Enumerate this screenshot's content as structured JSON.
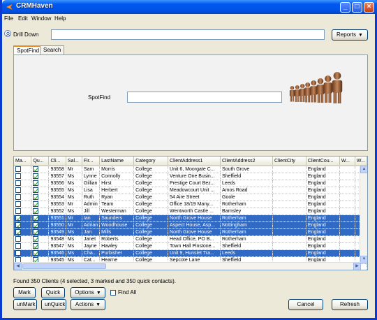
{
  "window": {
    "title": "CRMHaven"
  },
  "menu": [
    "File",
    "Edit",
    "Window",
    "Help"
  ],
  "drill_down": {
    "label": "Drill Down",
    "value": ""
  },
  "reports_button": "Reports",
  "tabs": [
    "SpotFind",
    "Search"
  ],
  "spotfind": {
    "label": "SpotFind",
    "value": ""
  },
  "grid": {
    "columns": [
      "Ma...",
      "Qu...",
      "Cli...",
      "Sal...",
      "Fir...",
      "LastName",
      "Category",
      "ClientAddress1",
      "ClientAddress2",
      "ClientCity",
      "ClientCou...",
      "W...",
      "W..."
    ],
    "rows": [
      {
        "mark": false,
        "quick": true,
        "id": "93558",
        "sal": "Mr",
        "first": "Sam",
        "last": "Morris",
        "cat": "College",
        "addr1": "Unit 6, Moorgate C...",
        "addr2": "South Grove",
        "city": "",
        "country": "England",
        "selected": false
      },
      {
        "mark": false,
        "quick": true,
        "id": "93557",
        "sal": "Ms",
        "first": "Lynne",
        "last": "Connolly",
        "cat": "College",
        "addr1": "Venture One Busin...",
        "addr2": "Sheffield",
        "city": "",
        "country": "England",
        "selected": false
      },
      {
        "mark": false,
        "quick": true,
        "id": "93556",
        "sal": "Ms",
        "first": "Gillian",
        "last": "Hirst",
        "cat": "College",
        "addr1": "Prestige Court Bez...",
        "addr2": "Leeds",
        "city": "",
        "country": "England",
        "selected": false
      },
      {
        "mark": false,
        "quick": true,
        "id": "93555",
        "sal": "Ms",
        "first": "Lisa",
        "last": "Herbert",
        "cat": "College",
        "addr1": "Meadowcourt Unit ...",
        "addr2": "Amos Road",
        "city": "",
        "country": "England",
        "selected": false
      },
      {
        "mark": false,
        "quick": true,
        "id": "93554",
        "sal": "Ms",
        "first": "Ruth",
        "last": "Ryan",
        "cat": "College",
        "addr1": "54 Aire Street",
        "addr2": "Goole",
        "city": "",
        "country": "England",
        "selected": false
      },
      {
        "mark": false,
        "quick": true,
        "id": "93553",
        "sal": "Mr",
        "first": "Admin",
        "last": "Team",
        "cat": "College",
        "addr1": "Office 18/19 Many...",
        "addr2": "Rotherham",
        "city": "",
        "country": "England",
        "selected": false
      },
      {
        "mark": false,
        "quick": true,
        "id": "93552",
        "sal": "Ms",
        "first": "Jill",
        "last": "Westerman",
        "cat": "College",
        "addr1": "Wentworth Castle ...",
        "addr2": "Barnsley",
        "city": "",
        "country": "England",
        "selected": false
      },
      {
        "mark": true,
        "quick": true,
        "id": "93551",
        "sal": "Mr",
        "first": "Ian",
        "last": "Saunders",
        "cat": "College",
        "addr1": "North Grove House",
        "addr2": "Rotherham",
        "city": "",
        "country": "England",
        "selected": true
      },
      {
        "mark": true,
        "quick": true,
        "id": "93550",
        "sal": "Mr",
        "first": "Adrian",
        "last": "Woodhouse",
        "cat": "College",
        "addr1": "Aspect House, Asp...",
        "addr2": "Nottingham",
        "city": "",
        "country": "England",
        "selected": true
      },
      {
        "mark": true,
        "quick": true,
        "id": "93549",
        "sal": "Ms",
        "first": "Jan",
        "last": "Mills",
        "cat": "College",
        "addr1": "North Grove House",
        "addr2": "Rotherham",
        "city": "",
        "country": "England",
        "selected": true
      },
      {
        "mark": false,
        "quick": true,
        "id": "93548",
        "sal": "Ms",
        "first": "Janet",
        "last": "Roberts",
        "cat": "College",
        "addr1": "Head Office, PO B...",
        "addr2": "Rotherham",
        "city": "",
        "country": "England",
        "selected": false
      },
      {
        "mark": false,
        "quick": true,
        "id": "93547",
        "sal": "Ms",
        "first": "Jayne",
        "last": "Hawley",
        "cat": "College",
        "addr1": "Town Hall Pinstone...",
        "addr2": "Sheffield",
        "city": "",
        "country": "England",
        "selected": false
      },
      {
        "mark": false,
        "quick": true,
        "id": "93546",
        "sal": "Ms",
        "first": "Cha...",
        "last": "Purbisher",
        "cat": "College",
        "addr1": "Unit 9, Hunslet Tra...",
        "addr2": "Leeds",
        "city": "",
        "country": "England",
        "selected": true
      },
      {
        "mark": false,
        "quick": true,
        "id": "93545",
        "sal": "Ms",
        "first": "Cat...",
        "last": "Hearne",
        "cat": "College",
        "addr1": "Sepcote Lane",
        "addr2": "Sheffield",
        "city": "",
        "country": "England",
        "selected": false
      },
      {
        "mark": false,
        "quick": true,
        "id": "93543",
        "sal": "Ms",
        "first": "Cat...",
        "last": "Smith",
        "cat": "College",
        "addr1": "Head Office",
        "addr2": "3d Normandy Stre...",
        "city": "",
        "country": "England",
        "selected": false
      },
      {
        "mark": false,
        "quick": true,
        "id": "93542",
        "sal": "Mr",
        "first": "Geo...",
        "last": "Trow",
        "cat": "College",
        "addr1": "Town Centre Camp...",
        "addr2": "Rotherham",
        "city": "",
        "country": "England",
        "selected": false
      }
    ]
  },
  "status": "Found 350 Clients (4 selected, 3 marked and 350 quick contacts).",
  "buttons": {
    "mark": "Mark",
    "quick": "Quick",
    "options": "Options",
    "unmark": "unMark",
    "unquick": "unQuick",
    "actions": "Actions",
    "cancel": "Cancel",
    "refresh": "Refresh"
  },
  "find_all": {
    "label": "Find All",
    "checked": false
  },
  "colors": {
    "selection": "#316ac5",
    "titlebar": "#0058ee"
  }
}
